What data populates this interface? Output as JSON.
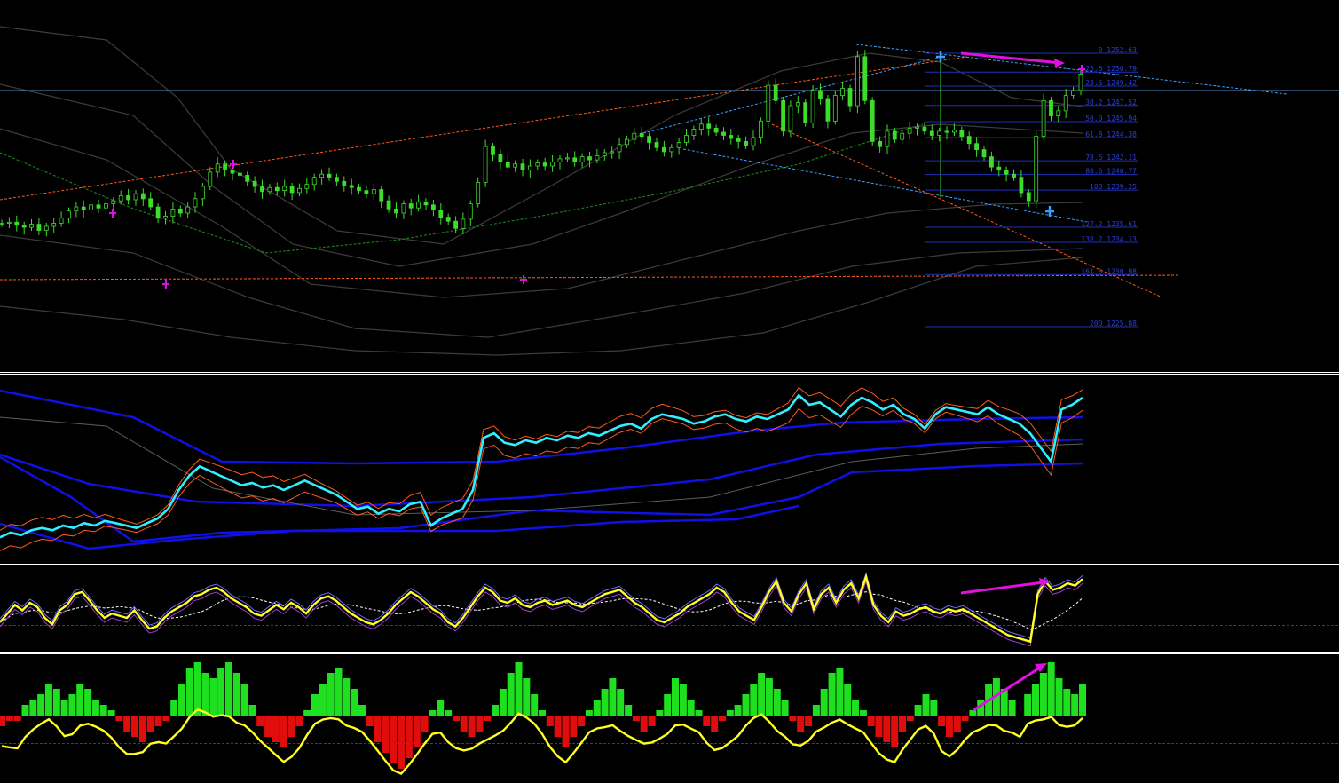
{
  "colors": {
    "background": "#000000",
    "separator": "#ffffff",
    "candle": "#3ddc2a",
    "fib_line": "#1f2fb8",
    "fib_text": "#2a3fd6",
    "trend_orange": "#ff5a1a",
    "trend_blue": "#3aa0ff",
    "ma_green": "#1b7a1b",
    "band_gray": "#3b3d3b",
    "cyan": "#30f0ff",
    "bb_blue": "#1010e8",
    "bb_orange": "#ff5a1a",
    "yellow": "#ffff20",
    "magenta": "#e010e0",
    "hist_up": "#1ee01e",
    "hist_down": "#e00d0d",
    "horizontal": "#5a8fbf"
  },
  "chart_data": [
    {
      "type": "candlestick",
      "panel": "price",
      "fib_levels": [
        {
          "label": "0 1252.63"
        },
        {
          "label": "23.6 1250.79"
        },
        {
          "label": "23.6 1249.42"
        },
        {
          "label": "38.2 1247.52"
        },
        {
          "label": "50.0 1245.94"
        },
        {
          "label": "61.8 1244.38"
        },
        {
          "label": "78.6 1242.11"
        },
        {
          "label": "88.6 1240.77"
        },
        {
          "label": "100 1239.25"
        },
        {
          "label": "127.2 1235.61"
        },
        {
          "label": "138.2 1234.13"
        },
        {
          "label": "161.8 1230.98"
        },
        {
          "label": "200 1225.88"
        }
      ],
      "close": [
        1236.0,
        1236.1,
        1235.8,
        1235.6,
        1235.9,
        1235.3,
        1235.7,
        1236.0,
        1236.5,
        1237.2,
        1237.6,
        1237.3,
        1237.8,
        1237.5,
        1237.9,
        1238.2,
        1238.7,
        1238.3,
        1238.9,
        1238.4,
        1237.6,
        1236.5,
        1236.7,
        1237.4,
        1237.0,
        1237.6,
        1238.4,
        1239.6,
        1241.0,
        1241.8,
        1241.2,
        1240.9,
        1240.7,
        1240.1,
        1239.6,
        1239.1,
        1239.5,
        1239.2,
        1239.6,
        1239.0,
        1239.4,
        1239.8,
        1240.5,
        1240.8,
        1240.5,
        1240.1,
        1239.7,
        1239.5,
        1239.2,
        1238.9,
        1239.3,
        1238.2,
        1237.4,
        1237.0,
        1237.9,
        1237.5,
        1238.1,
        1237.8,
        1237.3,
        1236.6,
        1236.2,
        1235.5,
        1236.4,
        1237.9,
        1240.0,
        1243.5,
        1242.7,
        1242.0,
        1241.5,
        1241.8,
        1241.2,
        1241.6,
        1241.9,
        1241.6,
        1242.0,
        1242.3,
        1242.4,
        1242.0,
        1242.5,
        1242.2,
        1242.6,
        1242.9,
        1243.0,
        1243.7,
        1244.2,
        1244.8,
        1244.5,
        1243.9,
        1243.4,
        1243.0,
        1243.4,
        1243.9,
        1244.6,
        1245.2,
        1245.7,
        1245.3,
        1244.9,
        1244.6,
        1244.3,
        1244.0,
        1243.6,
        1244.4,
        1246.0,
        1249.5,
        1248.0,
        1245.0,
        1247.5,
        1247.8,
        1245.8,
        1249.0,
        1248.2,
        1246.0,
        1248.5,
        1249.2,
        1247.5,
        1252.3,
        1248.0,
        1244.0,
        1243.5,
        1245.0,
        1244.2,
        1244.8,
        1245.3,
        1245.4,
        1245.0,
        1244.6,
        1245.0,
        1244.9,
        1245.1,
        1244.5,
        1243.8,
        1243.2,
        1242.5,
        1241.5,
        1241.2,
        1240.8,
        1240.5,
        1239.0,
        1238.2,
        1244.5,
        1248.0,
        1246.5,
        1247.0,
        1248.5,
        1249.0,
        1250.6
      ]
    },
    {
      "type": "line",
      "panel": "bollinger-oscillator",
      "series": [
        {
          "values": [
            40,
            42,
            41,
            43,
            44,
            43,
            45,
            44,
            46,
            45,
            47,
            46,
            45,
            44,
            46,
            48,
            52,
            60,
            66,
            70,
            68,
            66,
            64,
            62,
            63,
            61,
            62,
            60,
            62,
            64,
            62,
            60,
            58,
            55,
            52,
            53,
            50,
            52,
            51,
            54,
            55,
            45,
            48,
            50,
            52,
            60,
            82,
            84,
            80,
            79,
            81,
            80,
            82,
            81,
            83,
            82,
            84,
            83,
            85,
            87,
            88,
            86,
            90,
            92,
            91,
            90,
            88,
            89,
            91,
            92,
            90,
            89,
            91,
            90,
            92,
            94,
            100,
            96,
            97,
            94,
            91,
            96,
            99,
            97,
            94,
            96,
            92,
            90,
            86,
            92,
            95,
            94,
            93,
            92,
            95,
            92,
            90,
            88,
            84,
            78,
            72,
            94,
            96,
            99
          ]
        }
      ],
      "ylim": [
        30,
        105
      ]
    },
    {
      "type": "line",
      "panel": "rsi",
      "series": [
        {
          "values": [
            44,
            52,
            60,
            55,
            62,
            58,
            48,
            42,
            55,
            60,
            70,
            72,
            64,
            55,
            48,
            52,
            50,
            48,
            55,
            46,
            38,
            40,
            48,
            54,
            58,
            62,
            68,
            70,
            74,
            76,
            72,
            66,
            62,
            58,
            52,
            50,
            55,
            60,
            56,
            62,
            58,
            52,
            60,
            66,
            68,
            64,
            58,
            52,
            48,
            44,
            42,
            46,
            52,
            60,
            66,
            72,
            68,
            62,
            56,
            52,
            44,
            40,
            48,
            58,
            68,
            76,
            72,
            64,
            62,
            66,
            60,
            58,
            62,
            64,
            60,
            62,
            64,
            60,
            58,
            62,
            66,
            70,
            72,
            74,
            68,
            62,
            58,
            52,
            46,
            44,
            48,
            52,
            58,
            62,
            66,
            70,
            76,
            72,
            62,
            54,
            50,
            46,
            58,
            72,
            82,
            62,
            54,
            70,
            80,
            56,
            70,
            76,
            62,
            74,
            80,
            66,
            86,
            60,
            50,
            44,
            54,
            50,
            52,
            56,
            58,
            54,
            52,
            56,
            54,
            56,
            52,
            48,
            44,
            40,
            36,
            32,
            30,
            28,
            26,
            70,
            82,
            74,
            76,
            80,
            78,
            84
          ]
        }
      ],
      "ylim": [
        20,
        90
      ]
    },
    {
      "type": "bar",
      "panel": "histogram",
      "values": [
        -2,
        -1,
        -1,
        2,
        3,
        4,
        6,
        5,
        3,
        4,
        6,
        5,
        3,
        2,
        1,
        -1,
        -3,
        -4,
        -5,
        -3,
        -2,
        -1,
        3,
        6,
        9,
        10,
        8,
        7,
        9,
        10,
        8,
        6,
        2,
        -2,
        -4,
        -5,
        -6,
        -4,
        -2,
        1,
        4,
        6,
        8,
        9,
        7,
        5,
        2,
        -2,
        -5,
        -7,
        -9,
        -10,
        -8,
        -6,
        -3,
        1,
        3,
        1,
        -1,
        -3,
        -4,
        -3,
        -1,
        2,
        5,
        8,
        10,
        7,
        4,
        1,
        -2,
        -4,
        -6,
        -4,
        -2,
        1,
        3,
        5,
        7,
        5,
        2,
        -1,
        -3,
        -2,
        1,
        4,
        7,
        6,
        3,
        1,
        -2,
        -3,
        -1,
        1,
        2,
        4,
        6,
        8,
        7,
        5,
        3,
        -1,
        -3,
        -2,
        2,
        5,
        8,
        9,
        6,
        3,
        1,
        -2,
        -4,
        -5,
        -6,
        -3,
        -1,
        2,
        4,
        3,
        -2,
        -4,
        -3,
        -1,
        1,
        3,
        6,
        7,
        5,
        3,
        0,
        4,
        6,
        8,
        10,
        7,
        5,
        4,
        6
      ]
    }
  ]
}
